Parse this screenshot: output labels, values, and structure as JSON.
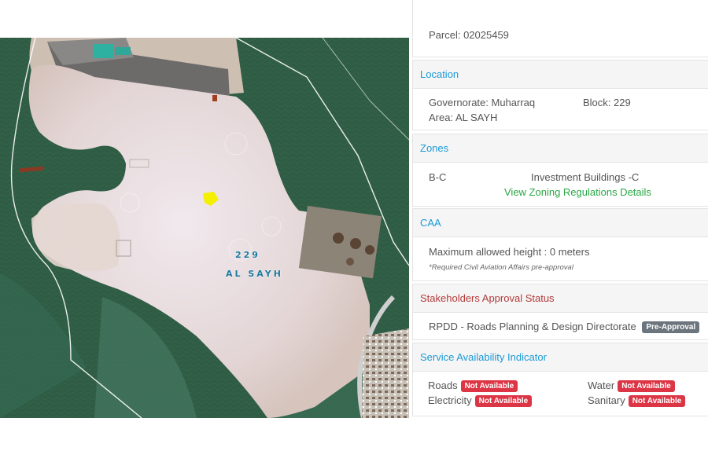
{
  "map": {
    "labels": {
      "block": "229",
      "area": "AL SAYH"
    }
  },
  "panel": {
    "parcel_partial": "Parcel: 02025459",
    "location": {
      "title": "Location",
      "governorate": "Governorate: Muharraq",
      "block": "Block: 229",
      "area": "Area: AL SAYH"
    },
    "zones": {
      "title": "Zones",
      "code": "B-C",
      "name": "Investment Buildings -C",
      "link": "View Zoning Regulations Details"
    },
    "caa": {
      "title": "CAA",
      "height": "Maximum allowed height : 0 meters",
      "note": "*Required Civil Aviation Affairs pre-approval"
    },
    "stakeholders": {
      "title": "Stakeholders Approval Status",
      "item": "RPDD - Roads Planning & Design Directorate",
      "badge": "Pre-Approval"
    },
    "services": {
      "title": "Service Availability Indicator",
      "roads": "Roads",
      "roads_status": "Not Available",
      "water": "Water",
      "water_status": "Not Available",
      "electricity": "Electricity",
      "electricity_status": "Not Available",
      "sanitary": "Sanitary",
      "sanitary_status": "Not Available"
    }
  },
  "colors": {
    "accent": "#1b9ad6",
    "danger": "#dc3545",
    "link": "#28a745",
    "muted": "#6c757d",
    "highlight": "#f5f000"
  }
}
